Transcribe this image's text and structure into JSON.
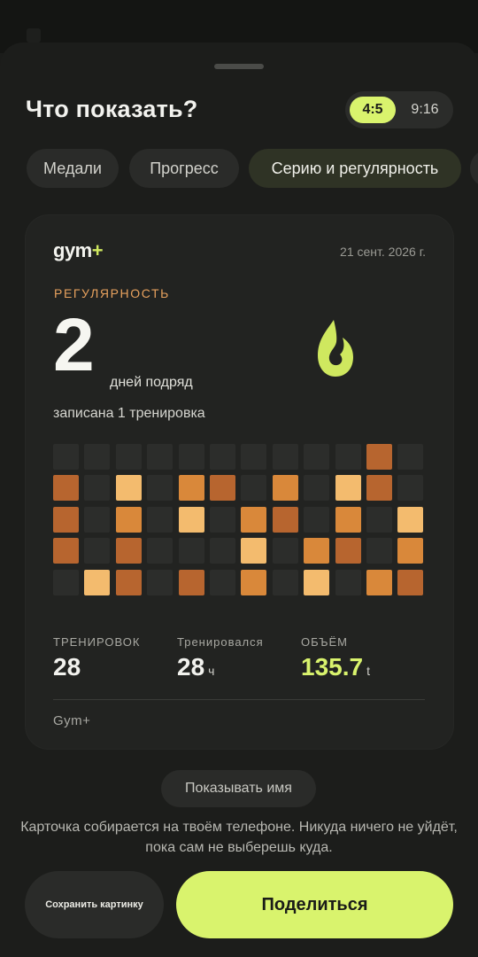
{
  "header": {
    "title": "Что показать?"
  },
  "aspect": {
    "options": [
      "4:5",
      "9:16"
    ],
    "selected": "4:5"
  },
  "tabs": [
    {
      "label": "Медали"
    },
    {
      "label": "Прогресс"
    },
    {
      "label": "Серию и регулярность",
      "active": true
    }
  ],
  "card": {
    "brand": "gym",
    "brand_plus": "+",
    "date": "21 сент. 2026 г.",
    "section": "РЕГУЛЯРНОСТЬ",
    "streak_value": "2",
    "streak_unit": "дней подряд",
    "subtext": "записана 1 тренировка",
    "flame_icon": "flame-icon",
    "heatmap": {
      "columns": 12,
      "rows": 5,
      "palette": {
        "0": "#2c2d2b",
        "1": "#b7652f",
        "2": "#d9883a",
        "3": "#f3bb6e"
      },
      "cells": [
        [
          0,
          0,
          0,
          0,
          0,
          0,
          0,
          0,
          0,
          0,
          1,
          0
        ],
        [
          1,
          0,
          3,
          0,
          2,
          1,
          0,
          2,
          0,
          3,
          1,
          0
        ],
        [
          1,
          0,
          2,
          0,
          3,
          0,
          2,
          1,
          0,
          2,
          0,
          3
        ],
        [
          1,
          0,
          1,
          0,
          0,
          0,
          3,
          0,
          2,
          1,
          0,
          2
        ],
        [
          0,
          3,
          1,
          0,
          1,
          0,
          2,
          0,
          3,
          0,
          2,
          1
        ]
      ]
    },
    "stats": [
      {
        "label": "ТРЕНИРОВОК",
        "value": "28",
        "unit": ""
      },
      {
        "label": "Тренировался",
        "value": "28",
        "unit": "ч"
      },
      {
        "label": "ОБЪЁМ",
        "value": "135.7",
        "unit": "t"
      }
    ],
    "footer_brand": "Gym+"
  },
  "controls": {
    "show_name": "Показывать имя",
    "note": "Карточка собирается на твоём телефоне. Никуда ничего не уйдёт, пока сам не выберешь куда.",
    "save_label": "Сохранить картинку",
    "share_label": "Поделиться"
  },
  "colors": {
    "accent": "#d9f36d",
    "section": "#e8a25e",
    "background": "#1c1d1b",
    "card": "#222321"
  }
}
